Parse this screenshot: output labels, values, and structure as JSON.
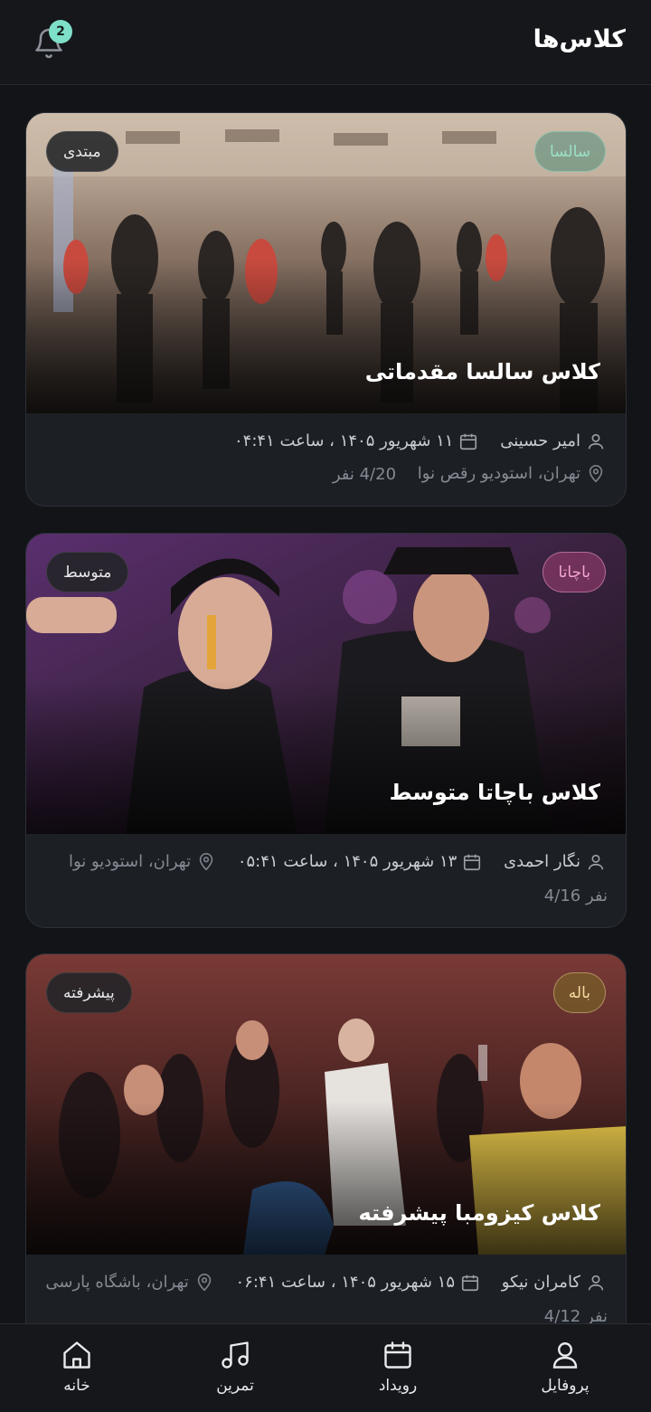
{
  "header": {
    "title": "کلاس‌ها",
    "notifications_count": "2"
  },
  "classes": [
    {
      "title": "کلاس سالسا مقدماتی",
      "style": "سالسا",
      "level": "مبتدی",
      "instructor": "امیر حسینی",
      "date_time": "۱۱ شهریور ۱۴۰۵ ، ساعت ۰۴:۴۱",
      "location": "تهران، استودیو رقص نوا",
      "capacity": "4/20 نفر",
      "style_color": "#9de0c7",
      "style_bg": "rgba(80,140,120,0.55)"
    },
    {
      "title": "کلاس باچاتا متوسط",
      "style": "باچاتا",
      "level": "متوسط",
      "instructor": "نگار احمدی",
      "date_time": "۱۳ شهریور ۱۴۰۵ ، ساعت ۰۵:۴۱",
      "location": "تهران، استودیو نوا",
      "capacity": "4/16 نفر",
      "style_color": "#f3a6cf",
      "style_bg": "rgba(150,60,110,0.6)"
    },
    {
      "title": "کلاس کیزومبا پیشرفته",
      "style": "باله",
      "level": "پیشرفته",
      "instructor": "کامران نیکو",
      "date_time": "۱۵ شهریور ۱۴۰۵ ، ساعت ۰۶:۴۱",
      "location": "تهران، باشگاه پارسی",
      "capacity": "4/12 نفر",
      "style_color": "#f4dba0",
      "style_bg": "rgba(120,95,40,0.7)"
    }
  ],
  "nav": {
    "home": "خانه",
    "practice": "تمرین",
    "events": "رویداد",
    "profile": "پروفایل"
  },
  "colors": {
    "background": "#121418",
    "card": "#1c1f24",
    "accent": "#7ee0c8"
  }
}
